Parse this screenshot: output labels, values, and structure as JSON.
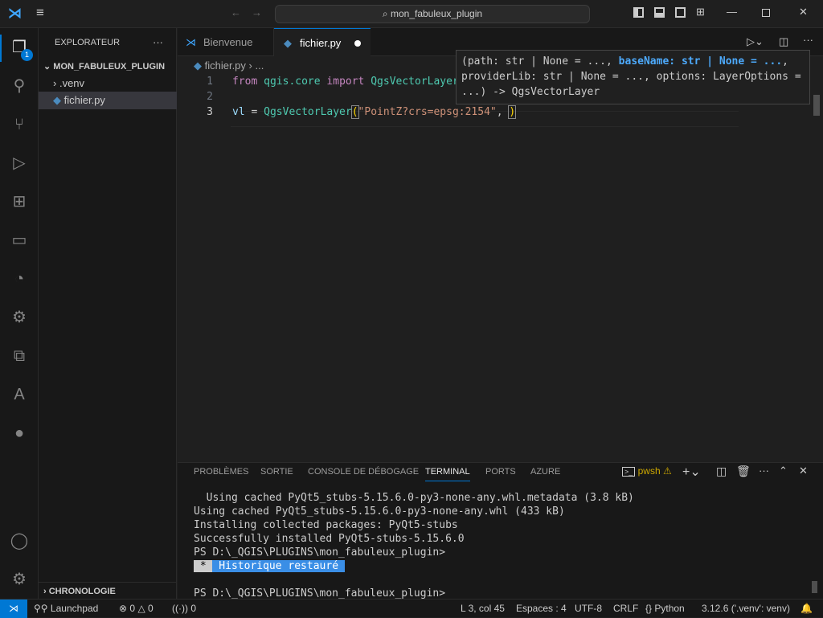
{
  "titlebar": {
    "search": "mon_fabuleux_plugin"
  },
  "activity": {
    "explorer_badge": "1"
  },
  "sidebar": {
    "title": "EXPLORATEUR",
    "more": "···",
    "folder": "MON_FABULEUX_PLUGIN",
    "items": [
      {
        "label": ".venv"
      },
      {
        "label": "fichier.py"
      }
    ],
    "timeline": "CHRONOLOGIE"
  },
  "tabs": [
    {
      "label": "Bienvenue"
    },
    {
      "label": "fichier.py"
    }
  ],
  "breadcrumb": {
    "file": "fichier.py",
    "rest": "..."
  },
  "code": {
    "lines": [
      "1",
      "2",
      "3"
    ],
    "l1_from": "from",
    "l1_mod": "qgis.core",
    "l1_import": "import",
    "l1_cls": "QgsVectorLayer",
    "l3_var": "vl",
    "l3_eq": " = ",
    "l3_cls": "QgsVectorLayer",
    "l3_open": "(",
    "l3_str": "\"PointZ?crs=epsg:2154\"",
    "l3_comma": ", ",
    "l3_close": ")"
  },
  "tooltip": {
    "a": "(path: str | None = ..., ",
    "b": "baseName: str | None = ...",
    "c": ",",
    "d": "providerLib: str | None = ..., options: LayerOptions =",
    "e": "...) -> QgsVectorLayer"
  },
  "panel": {
    "tabs": [
      "PROBLÈMES",
      "SORTIE",
      "CONSOLE DE DÉBOGAGE",
      "TERMINAL",
      "PORTS",
      "AZURE"
    ],
    "shell": "pwsh"
  },
  "terminal": {
    "lines": [
      "  Using cached PyQt5_stubs-5.15.6.0-py3-none-any.whl.metadata (3.8 kB)",
      "Using cached PyQt5_stubs-5.15.6.0-py3-none-any.whl (433 kB)",
      "Installing collected packages: PyQt5-stubs",
      "Successfully installed PyQt5-stubs-5.15.6.0",
      "PS D:\\_QGIS\\PLUGINS\\mon_fabuleux_plugin>"
    ],
    "restored_star": " * ",
    "restored": " Historique restauré ",
    "prompt": "PS D:\\_QGIS\\PLUGINS\\mon_fabuleux_plugin>"
  },
  "status": {
    "launchpad": "Launchpad",
    "errors": "0",
    "warnings": "0",
    "ports": "0",
    "position": "L 3, col 45",
    "spaces": "Espaces : 4",
    "encoding": "UTF-8",
    "eol": "CRLF",
    "language": "Python",
    "interpreter": "3.12.6 ('.venv': venv)"
  },
  "colors": {
    "accent": "#0078d4",
    "keyword": "#c586c0",
    "class": "#4ec9b0",
    "string": "#ce9178",
    "highlight": "#4daafc"
  }
}
